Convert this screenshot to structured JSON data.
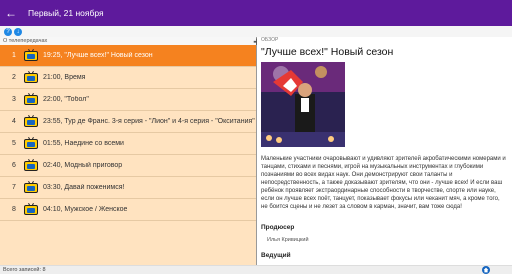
{
  "header": {
    "title": "Первый, 21 ноября"
  },
  "left": {
    "header_label": "О телепередачах"
  },
  "programs": [
    {
      "num": "1",
      "text": "19:25, \"Лучше всех!\" Новый сезон"
    },
    {
      "num": "2",
      "text": "21:00, Время"
    },
    {
      "num": "3",
      "text": "22:00, \"Тобол\""
    },
    {
      "num": "4",
      "text": "23:55, Тур де Франс. 3-я серия - \"Лион\" и 4-я серия - \"Окситания\""
    },
    {
      "num": "5",
      "text": "01:55, Наедине со всеми"
    },
    {
      "num": "6",
      "text": "02:40, Модный приговор"
    },
    {
      "num": "7",
      "text": "03:30, Давай поженимся!"
    },
    {
      "num": "8",
      "text": "04:10, Мужское / Женское"
    }
  ],
  "detail": {
    "small_label": "ОБЗОР",
    "title": "\"Лучше всех!\" Новый сезон",
    "description": "Маленькие участники очаровывают и удивляют зрителей акробатическими номерами и танцами, стихами и песнями, игрой на музыкальных инструментах и глубокими познаниями во всех видах наук. Они демонстрируют свои таланты и непосредственность, а также доказывают зрителям, что они - лучше всех! И если ваш ребёнок проявляет экстраординарные способности в творчестве, спорте или науке, если он лучше всех поёт, танцует, показывает фокусы или чеканит мяч, а кроме того, не боится сцены и не лезет за словом в карман, значит, вам тоже сюда!",
    "producer_label": "Продюсер",
    "producer_name": "Илья Кривицкий",
    "host_label": "Ведущий"
  },
  "status": {
    "text": "Всего записей: 8"
  },
  "colors": {
    "appbar": "#5e1a9c",
    "selected": "#f5821f",
    "list_bg": "#ffe3c0"
  }
}
